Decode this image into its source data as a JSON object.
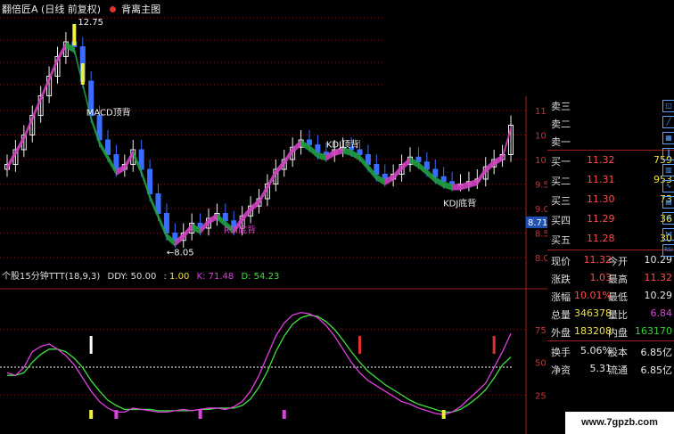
{
  "window": {
    "title": "翻倍匠A (日线 前复权)",
    "indicator_name": "背离主图"
  },
  "main_chart": {
    "price_ticks": [
      "11.00",
      "10.50",
      "10.00",
      "9.50",
      "9.00",
      "8.50",
      "8.00"
    ],
    "current_price_tag": "8.71",
    "annotations": {
      "high": "12.75",
      "low": "←8.05",
      "macd_top": "MACD顶背",
      "kdj_top": "KDJ顶背",
      "rsi_bottom": "RSI底背",
      "kdj_bottom_1": "KDJ底背",
      "kdj_bottom_2": "KDJ底背"
    },
    "close_prices": [
      9.9,
      10.2,
      10.5,
      10.9,
      11.3,
      11.7,
      12.1,
      12.4,
      12.3,
      11.6,
      10.9,
      10.4,
      10.1,
      9.8,
      9.9,
      10.2,
      9.8,
      9.3,
      8.9,
      8.5,
      8.35,
      8.5,
      8.7,
      8.6,
      8.8,
      8.9,
      8.75,
      8.6,
      8.85,
      9.05,
      9.2,
      9.5,
      9.8,
      10.0,
      10.25,
      10.4,
      10.3,
      10.15,
      10.1,
      10.2,
      10.25,
      10.2,
      10.1,
      9.9,
      9.7,
      9.6,
      9.7,
      9.9,
      10.05,
      9.95,
      9.8,
      9.65,
      9.55,
      9.5,
      9.5,
      9.55,
      9.6,
      9.85,
      10.0,
      10.1,
      10.7
    ]
  },
  "sub_chart": {
    "title": "个股15分钟TTT(18,9,3)",
    "ddy": "DDY: 50.00",
    "val_100": ": 1.00",
    "k": "K: 71.48",
    "d": "D: 54.23",
    "ticks": [
      "75.00",
      "50.00",
      "25"
    ],
    "k_values": [
      42,
      40,
      46,
      58,
      62,
      64,
      60,
      55,
      48,
      38,
      28,
      20,
      15,
      12,
      12,
      15,
      14,
      13,
      12,
      12,
      13,
      14,
      13,
      14,
      15,
      15,
      14,
      16,
      20,
      28,
      40,
      55,
      70,
      80,
      86,
      88,
      87,
      84,
      78,
      70,
      60,
      50,
      42,
      36,
      32,
      28,
      24,
      20,
      18,
      15,
      13,
      11,
      10,
      12,
      16,
      22,
      28,
      34,
      46,
      58,
      72
    ],
    "d_values": [
      40,
      40,
      42,
      50,
      56,
      60,
      60,
      58,
      53,
      46,
      36,
      28,
      21,
      17,
      14,
      14,
      14,
      14,
      13,
      13,
      13,
      13,
      13,
      14,
      14,
      15,
      15,
      15,
      17,
      22,
      31,
      43,
      58,
      70,
      79,
      84,
      86,
      85,
      81,
      75,
      67,
      58,
      50,
      43,
      38,
      33,
      29,
      25,
      21,
      18,
      16,
      14,
      12,
      12,
      14,
      18,
      23,
      29,
      38,
      48,
      54
    ]
  },
  "quote_panel": {
    "sell_labels": [
      "卖三",
      "卖二",
      "卖一"
    ],
    "buy_rows": [
      {
        "label": "买一",
        "price": "11.32",
        "vol": "759"
      },
      {
        "label": "买二",
        "price": "11.31",
        "vol": "953"
      },
      {
        "label": "买三",
        "price": "11.30",
        "vol": "73"
      },
      {
        "label": "买四",
        "price": "11.29",
        "vol": "36"
      },
      {
        "label": "买五",
        "price": "11.28",
        "vol": "30"
      }
    ],
    "stats": [
      {
        "l1": "现价",
        "v1": "11.32",
        "l2": "今开",
        "v2": "10.29"
      },
      {
        "l1": "涨跌",
        "v1": "1.03",
        "l2": "最高",
        "v2": "11.32"
      },
      {
        "l1": "涨幅",
        "v1": "10.01%",
        "l2": "最低",
        "v2": "10.29"
      },
      {
        "l1": "总量",
        "v1": "346378",
        "l2": "量比",
        "v2": "6.84"
      },
      {
        "l1": "外盘",
        "v1": "183208",
        "l2": "内盘",
        "v2": "163170"
      }
    ],
    "stats2": [
      {
        "l1": "换手",
        "v1": "5.06%",
        "l2": "股本",
        "v2": "6.85亿"
      },
      {
        "l1": "净资",
        "v1": "5.31",
        "l2": "流通",
        "v2": "6.85亿"
      }
    ]
  },
  "toolbar": {
    "rsi_label": "RSI"
  },
  "watermark": "www.7gpzb.com"
}
